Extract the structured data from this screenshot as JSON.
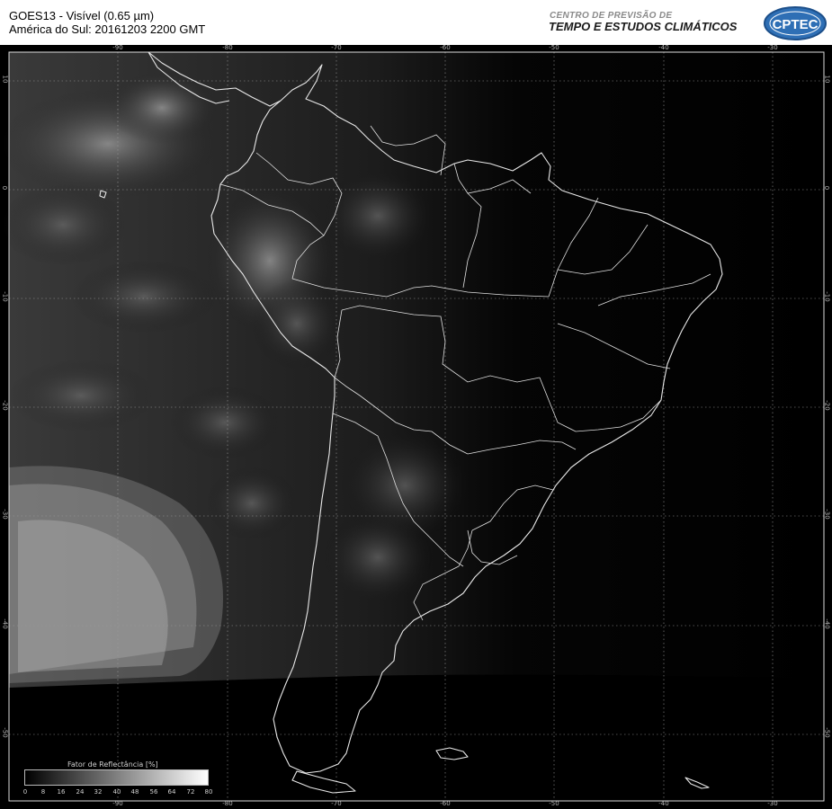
{
  "header": {
    "title_line1": "GOES13 - Visível (0.65 µm)",
    "title_line2": "América do Sul: 20161203 2200 GMT",
    "brand_line1": "CENTRO DE PREVISÃO DE",
    "brand_line2": "TEMPO E ESTUDOS CLIMÁTICOS",
    "logo_text": "CPTEC"
  },
  "map": {
    "longitude_labels": [
      "-90",
      "-80",
      "-70",
      "-60",
      "-50",
      "-40",
      "-30"
    ],
    "latitude_labels": [
      "10",
      "0",
      "-10",
      "-20",
      "-30",
      "-40",
      "-50"
    ],
    "background_color": "#000000",
    "coastline_color": "#e8e8e8",
    "grid_color": "#9a9a9a"
  },
  "legend": {
    "title": "Fator de Reflectância [%]",
    "ticks": [
      "0",
      "8",
      "16",
      "24",
      "32",
      "40",
      "48",
      "56",
      "64",
      "72",
      "80"
    ]
  }
}
